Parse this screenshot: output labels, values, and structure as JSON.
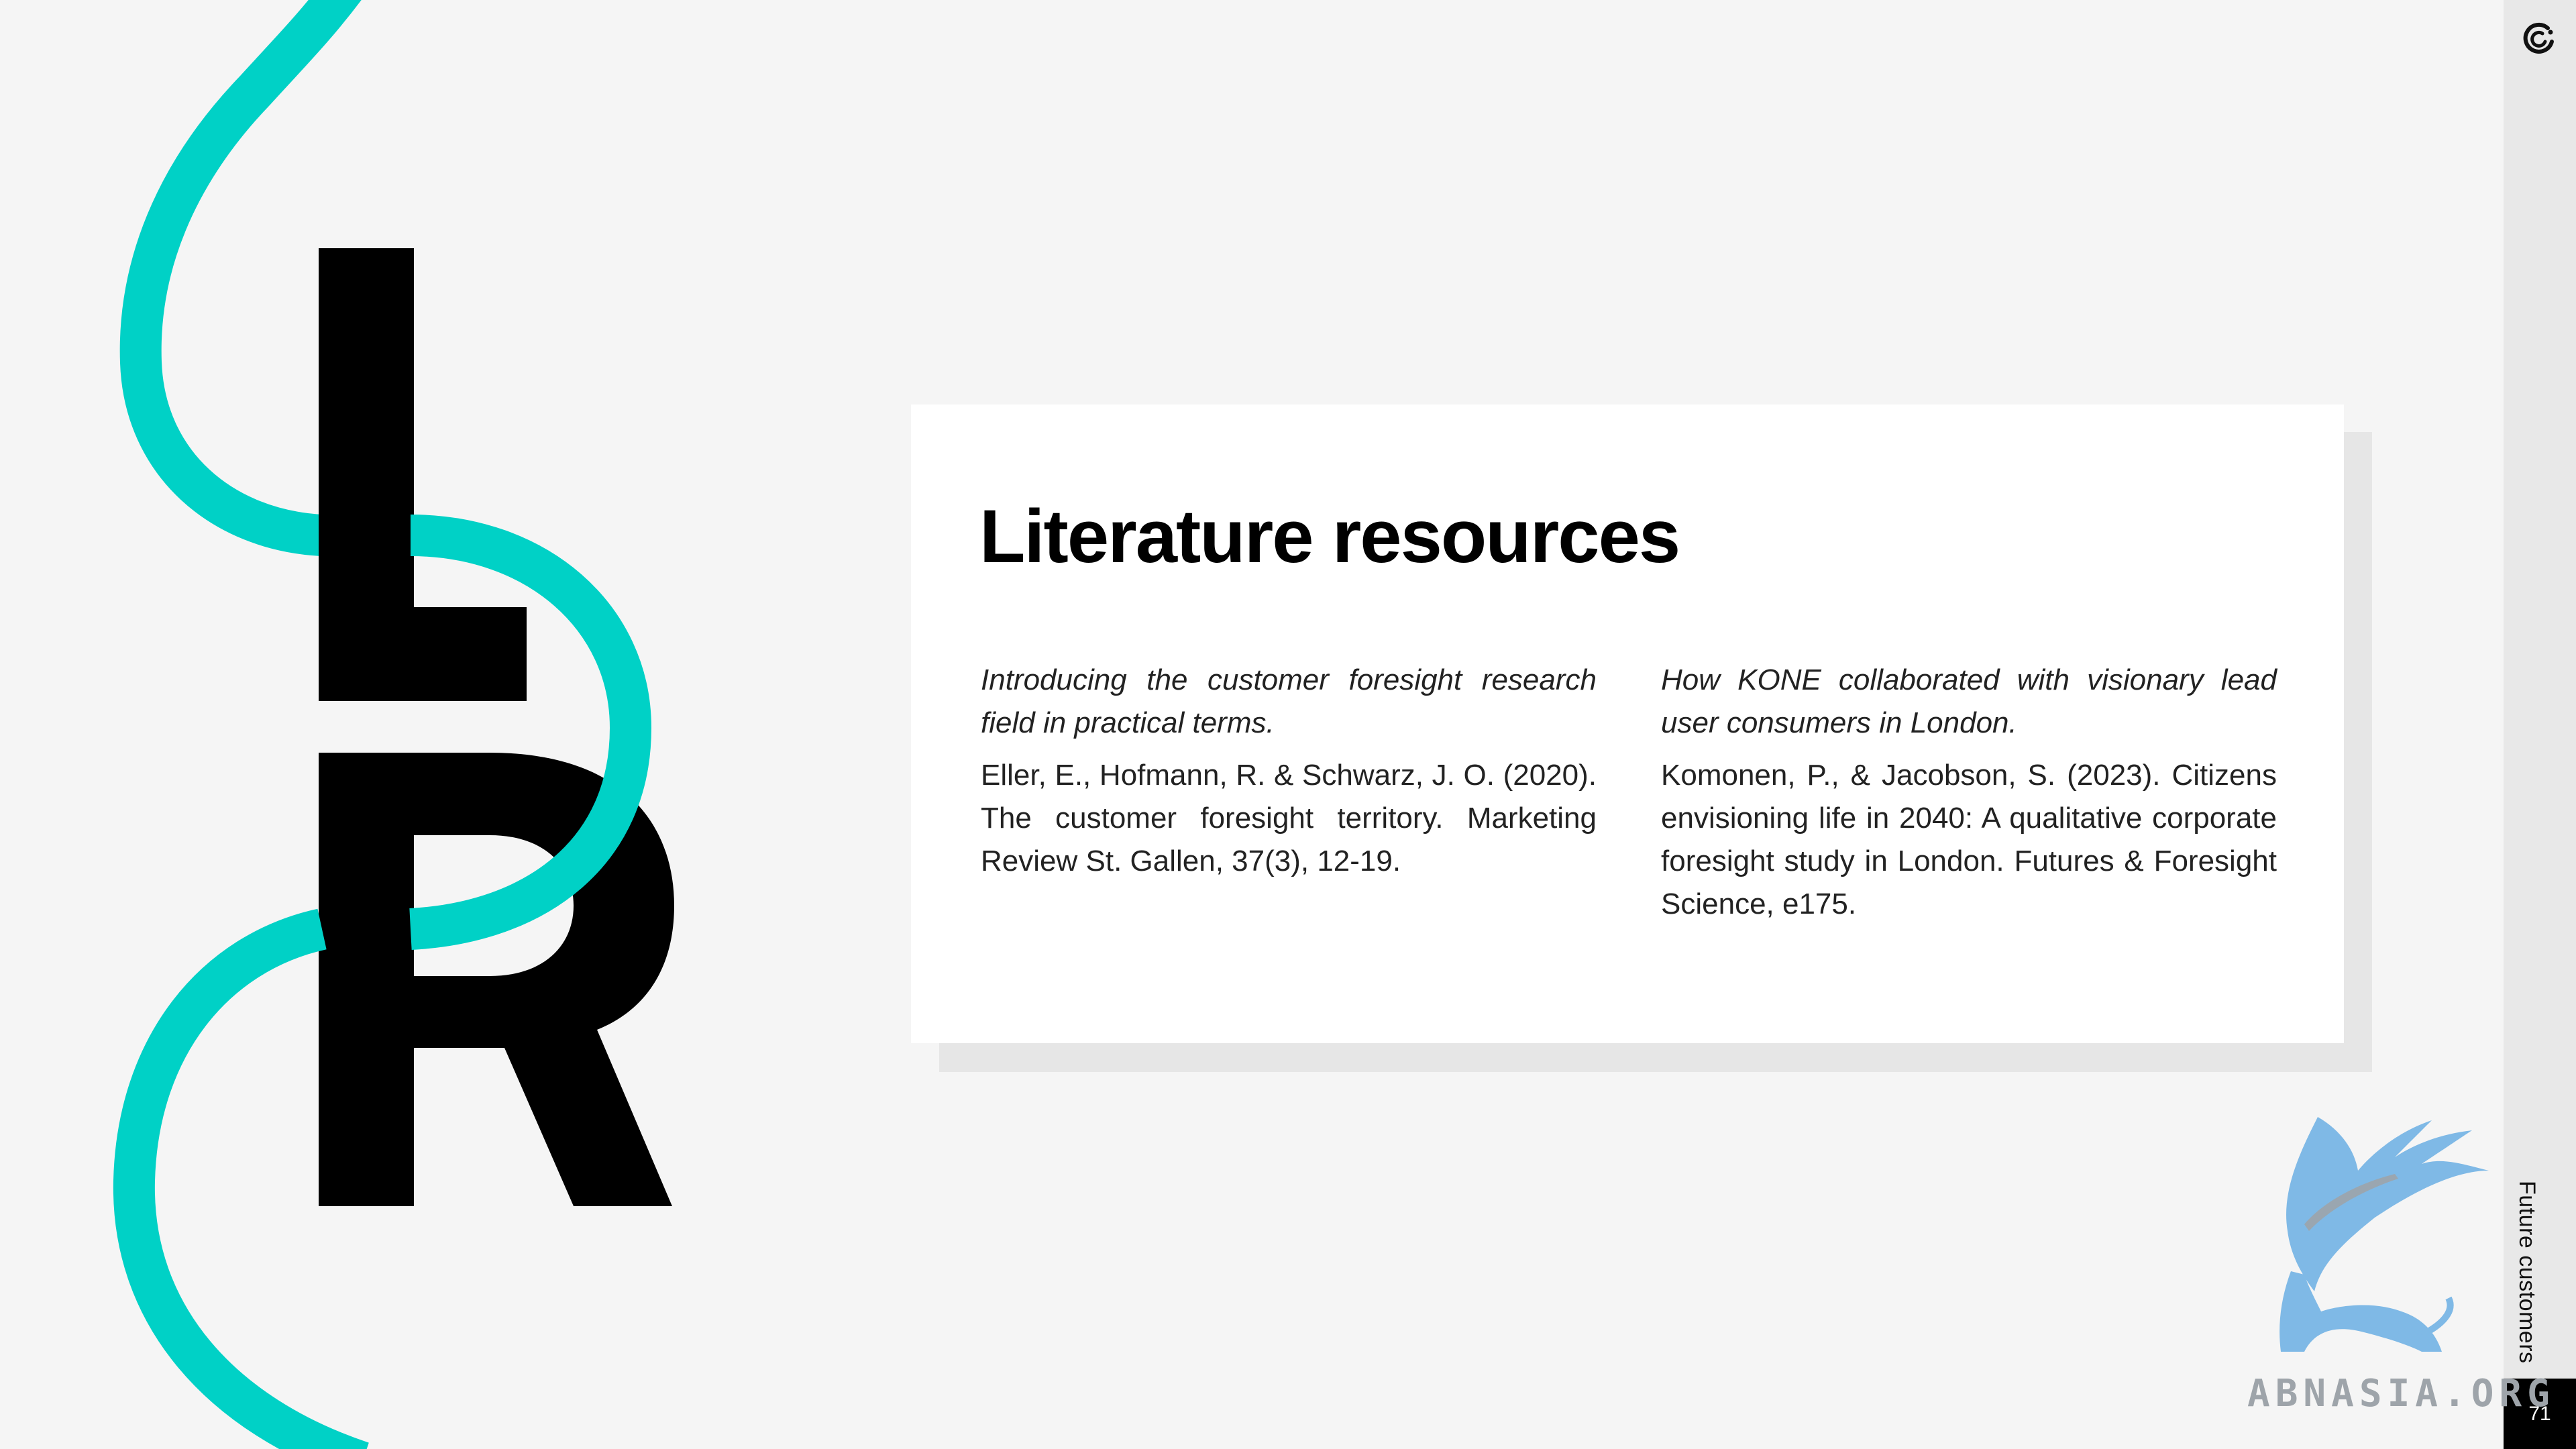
{
  "slide": {
    "title": "Literature resources",
    "section_label": "Future customers",
    "page_number": "71"
  },
  "decoration": {
    "big_letters": [
      "L",
      "R"
    ],
    "accent_color": "#00d1c6",
    "letter_color": "#000000",
    "brand_icon": "circular-c-logo-icon"
  },
  "references": [
    {
      "description": "Introducing the customer foresight research field in practical terms.",
      "citation": "Eller, E., Hofmann, R. & Schwarz, J. O. (2020). The customer foresight territory. Marketing Review St. Gallen, 37(3), 12-19."
    },
    {
      "description": "How KONE collaborated with visionary lead user consumers in London.",
      "citation": "Komonen, P., & Jacobson, S. (2023). Citizens envisioning life in 2040: A qualitative corporate foresight study in London. Futures & Foresight Science, e175."
    }
  ],
  "watermark": {
    "text": "ABNASIA.ORG",
    "icon": "griffin-icon",
    "color": "#7fb9e6"
  }
}
